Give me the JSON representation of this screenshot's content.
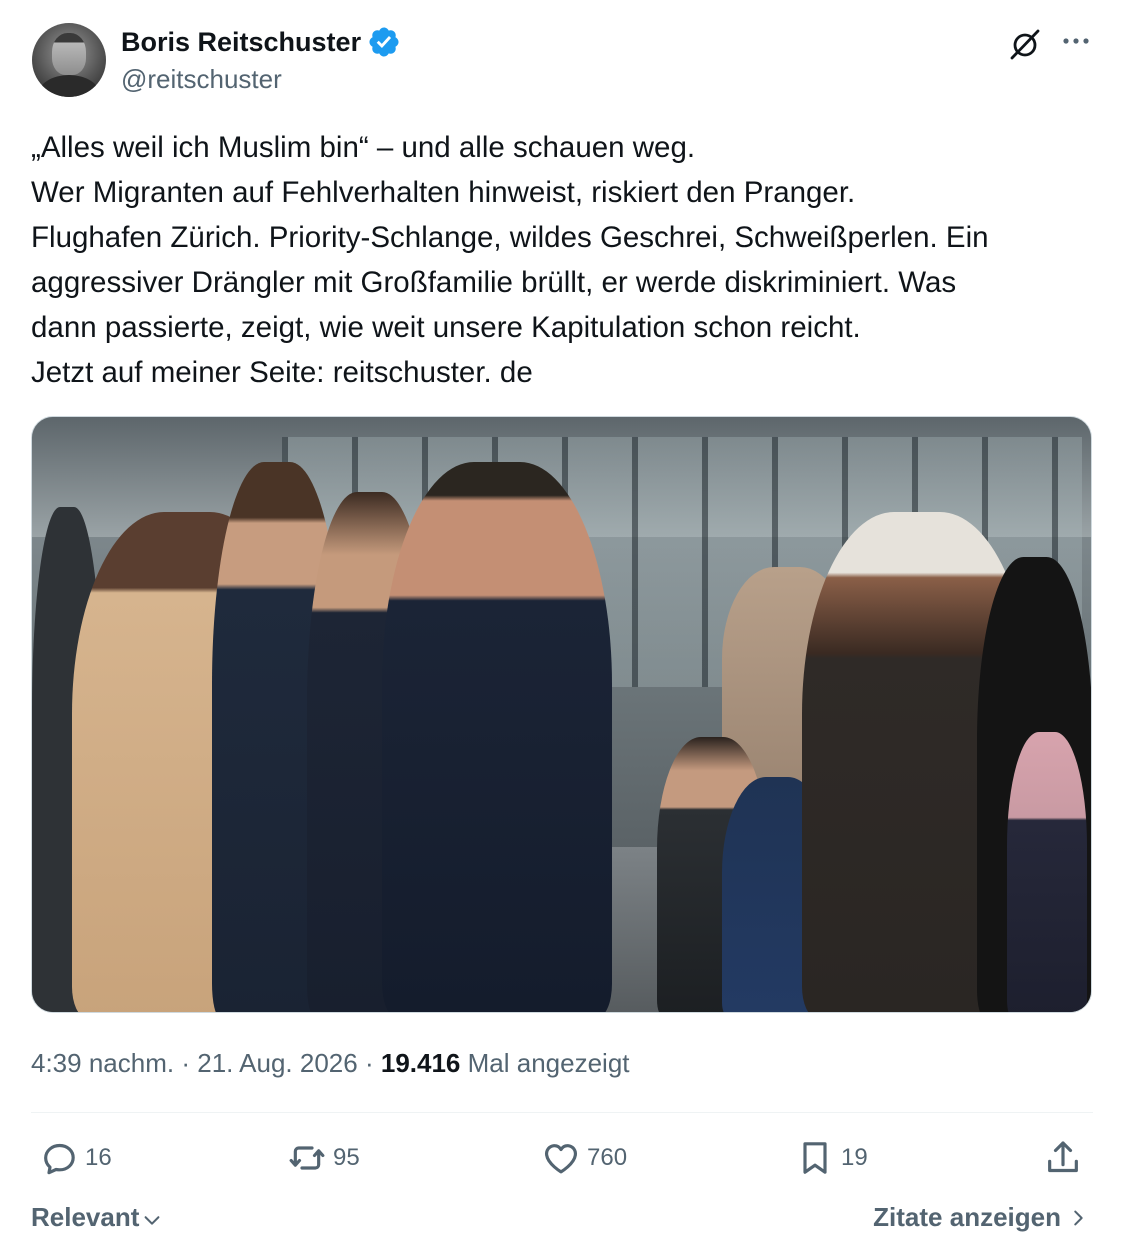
{
  "author": {
    "display_name": "Boris Reitschuster",
    "handle": "@reitschuster",
    "verified": true
  },
  "tweet": {
    "lines": [
      "„Alles weil ich Muslim bin“ – und alle schauen weg.",
      "Wer Migranten auf Fehlverhalten hinweist, riskiert den Pranger.",
      "Flughafen Zürich. Priority-Schlange, wildes Geschrei, Schweißperlen. Ein",
      "aggressiver Drängler mit Großfamilie brüllt, er werde diskriminiert. Was",
      "dann passierte, zeigt, wie weit unsere Kapitulation schon reicht.",
      "Jetzt auf meiner Seite: reitschuster. de"
    ]
  },
  "meta": {
    "time": "4:39 nachm.",
    "separator": "·",
    "date": "21. Aug. 2026",
    "views_count": "19.416",
    "views_label": "Mal angezeigt"
  },
  "actions": {
    "replies": "16",
    "retweets": "95",
    "likes": "760",
    "bookmarks": "19"
  },
  "footer": {
    "sort_label": "Relevant",
    "quotes_label": "Zitate anzeigen"
  },
  "colors": {
    "text_primary": "#0f1419",
    "text_secondary": "#536471",
    "verified_blue": "#1d9bf0",
    "divider": "#eff3f4"
  },
  "icons": [
    "grok-icon",
    "more-icon",
    "verified-badge-icon",
    "reply-icon",
    "retweet-icon",
    "like-icon",
    "bookmark-icon",
    "share-icon",
    "chevron-down-icon",
    "chevron-right-icon"
  ]
}
